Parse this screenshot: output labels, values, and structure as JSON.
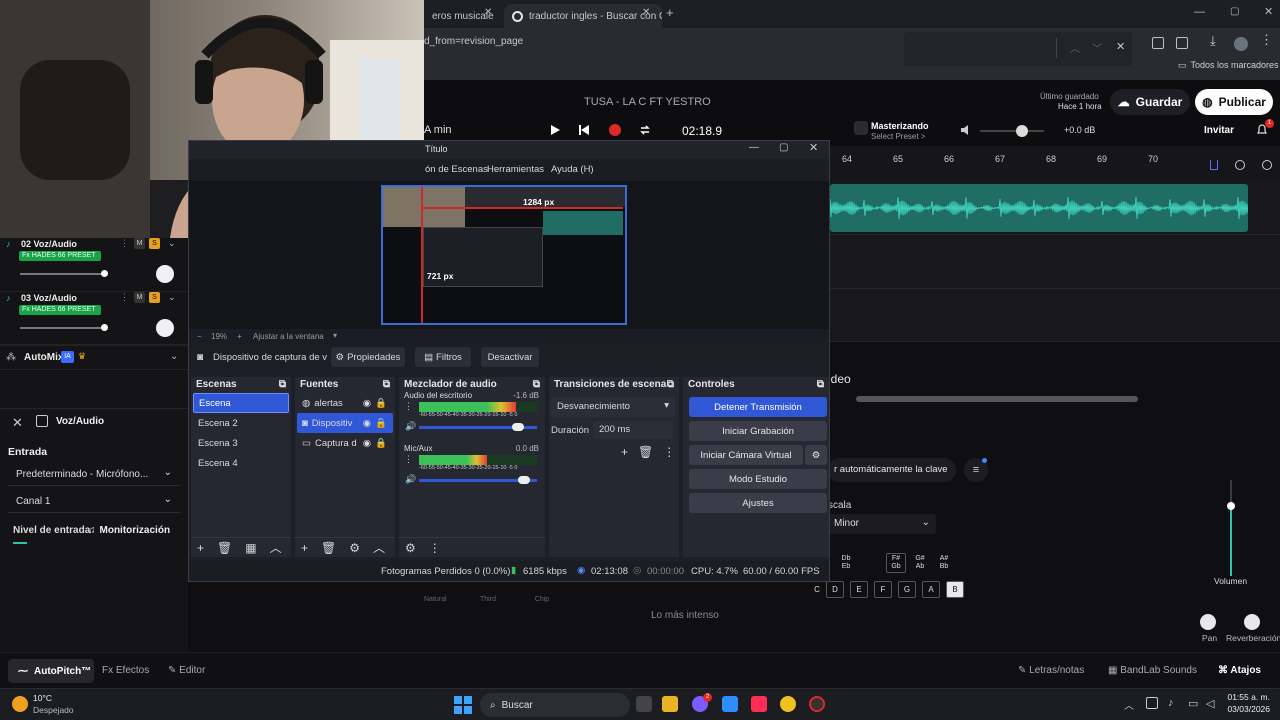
{
  "browser": {
    "tabs": [
      {
        "label": "eros musicale"
      },
      {
        "label": "traductor ingles - Buscar con G"
      }
    ],
    "address": "d_from=revision_page",
    "bookmarks_label": "Todos los marcadores"
  },
  "bandlab": {
    "song_title": "TUSA - LA C FT YESTRO",
    "time": "02:18.9",
    "min_label": "A min",
    "last_saved_label": "Último guardado",
    "last_saved_value": "Hace 1 hora",
    "save_button": "Guardar",
    "publish_button": "Publicar",
    "mastering_title": "Masterizando",
    "mastering_sub": "Select Preset >",
    "volume_db": "+0.0 dB",
    "invite": "Invitar",
    "notifications_count": "1",
    "ruler_marks": [
      "64",
      "65",
      "66",
      "67",
      "68",
      "69",
      "70"
    ],
    "tracks": [
      {
        "number_name": "02 Voz/Audio",
        "fx": "Fx HADES 66 PRESET"
      },
      {
        "number_name": "03 Voz/Audio",
        "fx": "Fx HADES 66 PRESET"
      }
    ],
    "automix": "AutoMix",
    "ia_badge": "IA",
    "video_label": "ideo",
    "auto_key_label": "r automáticamente la clave",
    "scale_label": "scala",
    "scale_value": "Minor",
    "volume_label": "Volumen",
    "pan_label": "Pan",
    "reverb_label": "Reverberación",
    "most_intense": "Lo más intenso",
    "style_labels": [
      "Natural",
      "Third",
      "Chip"
    ],
    "keys": [
      "C",
      "D",
      "E",
      "F",
      "G",
      "A",
      "B"
    ],
    "sharp_keys": [
      "Db\nEb",
      "F#\nGb",
      "G#\nAb",
      "A#\nBb"
    ],
    "voice_panel": {
      "title": "Voz/Audio",
      "input_label": "Entrada",
      "input_value": "Predeterminado - Micrófono...",
      "channel_value": "Canal 1",
      "level_label": "Nivel de entrada",
      "monitor_label": "Monitorización"
    },
    "bottom_tabs": {
      "autopitch": "AutoPitch™",
      "effects": "Efectos",
      "editor": "Editor",
      "lyrics": "Letras/notas",
      "sounds": "BandLab Sounds",
      "shortcuts": "Atajos"
    }
  },
  "obs": {
    "title": "Título",
    "menu": [
      "ón de Escenas",
      "Herramientas",
      "Ayuda (H)"
    ],
    "preview_badge_w": "1284 px",
    "preview_badge_h": "721 px",
    "zoom": "19%",
    "fit_label": "Ajustar a la ventana",
    "source_name": "Dispositivo de captura de v",
    "properties_button": "Propiedades",
    "filters_button": "Filtros",
    "deactivate_button": "Desactivar",
    "scenes_title": "Escenas",
    "scenes": [
      "Escena",
      "Escena 2",
      "Escena 3",
      "Escena 4"
    ],
    "sources_title": "Fuentes",
    "sources": [
      "alertas",
      "Dispositiv",
      "Captura d"
    ],
    "mixer_title": "Mezclador de audio",
    "mixer": [
      {
        "name": "Audio del escritorio",
        "db": "-1.6 dB",
        "level": 0.82,
        "volume": 0.88
      },
      {
        "name": "Mic/Aux",
        "db": "0.0 dB",
        "level": 0.58,
        "volume": 0.93
      }
    ],
    "meter_scale": "-60-55-50-45-40-35-30-25-20-15-10 -5 0",
    "transitions_title": "Transiciones de escena",
    "transition_value": "Desvanecimiento",
    "duration_label": "Duración",
    "duration_value": "200 ms",
    "controls_title": "Controles",
    "controls": {
      "stop_stream": "Detener Transmisión",
      "start_rec": "Iniciar Grabación",
      "virtual_cam": "Iniciar Cámara Virtual",
      "studio_mode": "Modo Estudio",
      "settings": "Ajustes"
    },
    "status": {
      "dropped": "Fotogramas Perdidos 0 (0.0%)",
      "kbps": "6185 kbps",
      "stream_time": "02:13:08",
      "rec_time": "00:00:00",
      "cpu": "CPU: 4.7%",
      "fps": "60.00 / 60.00 FPS"
    }
  },
  "taskbar": {
    "weather_temp": "10°C",
    "weather_desc": "Despejado",
    "search": "Buscar",
    "clock_time": "01:55 a. m.",
    "clock_date": "03/03/2026",
    "chat_badge": "2"
  }
}
